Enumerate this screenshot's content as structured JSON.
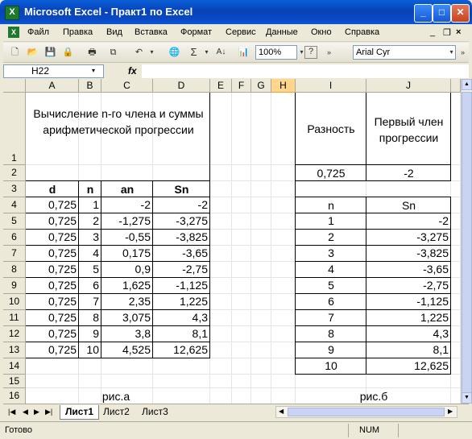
{
  "window": {
    "title": "Microsoft Excel - Практ1 по Excel",
    "app_icon": "X"
  },
  "menu": [
    "Файл",
    "Правка",
    "Вид",
    "Вставка",
    "Формат",
    "Сервис",
    "Данные",
    "Окно",
    "Справка"
  ],
  "toolbar": {
    "zoom": "100%",
    "font_name": "Arial Cyr",
    "autosum": "Σ"
  },
  "formula_bar": {
    "name_box": "H22",
    "fx": "fx",
    "formula": ""
  },
  "columns": [
    "A",
    "B",
    "C",
    "D",
    "E",
    "F",
    "G",
    "H",
    "I",
    "J"
  ],
  "rows": [
    "1",
    "2",
    "3",
    "4",
    "5",
    "6",
    "7",
    "8",
    "9",
    "10",
    "11",
    "12",
    "13",
    "14",
    "15",
    "16"
  ],
  "left_table": {
    "title": "Вычисление n-го члена и суммы арифметической прогрессии",
    "headers": [
      "d",
      "n",
      "an",
      "Sn"
    ],
    "data": [
      [
        "0,725",
        "1",
        "-2",
        "-2"
      ],
      [
        "0,725",
        "2",
        "-1,275",
        "-3,275"
      ],
      [
        "0,725",
        "3",
        "-0,55",
        "-3,825"
      ],
      [
        "0,725",
        "4",
        "0,175",
        "-3,65"
      ],
      [
        "0,725",
        "5",
        "0,9",
        "-2,75"
      ],
      [
        "0,725",
        "6",
        "1,625",
        "-1,125"
      ],
      [
        "0,725",
        "7",
        "2,35",
        "1,225"
      ],
      [
        "0,725",
        "8",
        "3,075",
        "4,3"
      ],
      [
        "0,725",
        "9",
        "3,8",
        "8,1"
      ],
      [
        "0,725",
        "10",
        "4,525",
        "12,625"
      ]
    ],
    "caption": "рис.а"
  },
  "right_table": {
    "header_i": "Разность",
    "header_j": "Первый член прогрессии",
    "value_i": "0,725",
    "value_j": "-2",
    "headers": [
      "n",
      "Sn"
    ],
    "data": [
      [
        "1",
        "-2"
      ],
      [
        "2",
        "-3,275"
      ],
      [
        "3",
        "-3,825"
      ],
      [
        "4",
        "-3,65"
      ],
      [
        "5",
        "-2,75"
      ],
      [
        "6",
        "-1,125"
      ],
      [
        "7",
        "1,225"
      ],
      [
        "8",
        "4,3"
      ],
      [
        "9",
        "8,1"
      ],
      [
        "10",
        "12,625"
      ]
    ],
    "caption": "рис.б"
  },
  "sheets": [
    "Лист1",
    "Лист2",
    "Лист3"
  ],
  "active_sheet": "Лист1",
  "status": {
    "left": "Готово",
    "num": "NUM"
  }
}
